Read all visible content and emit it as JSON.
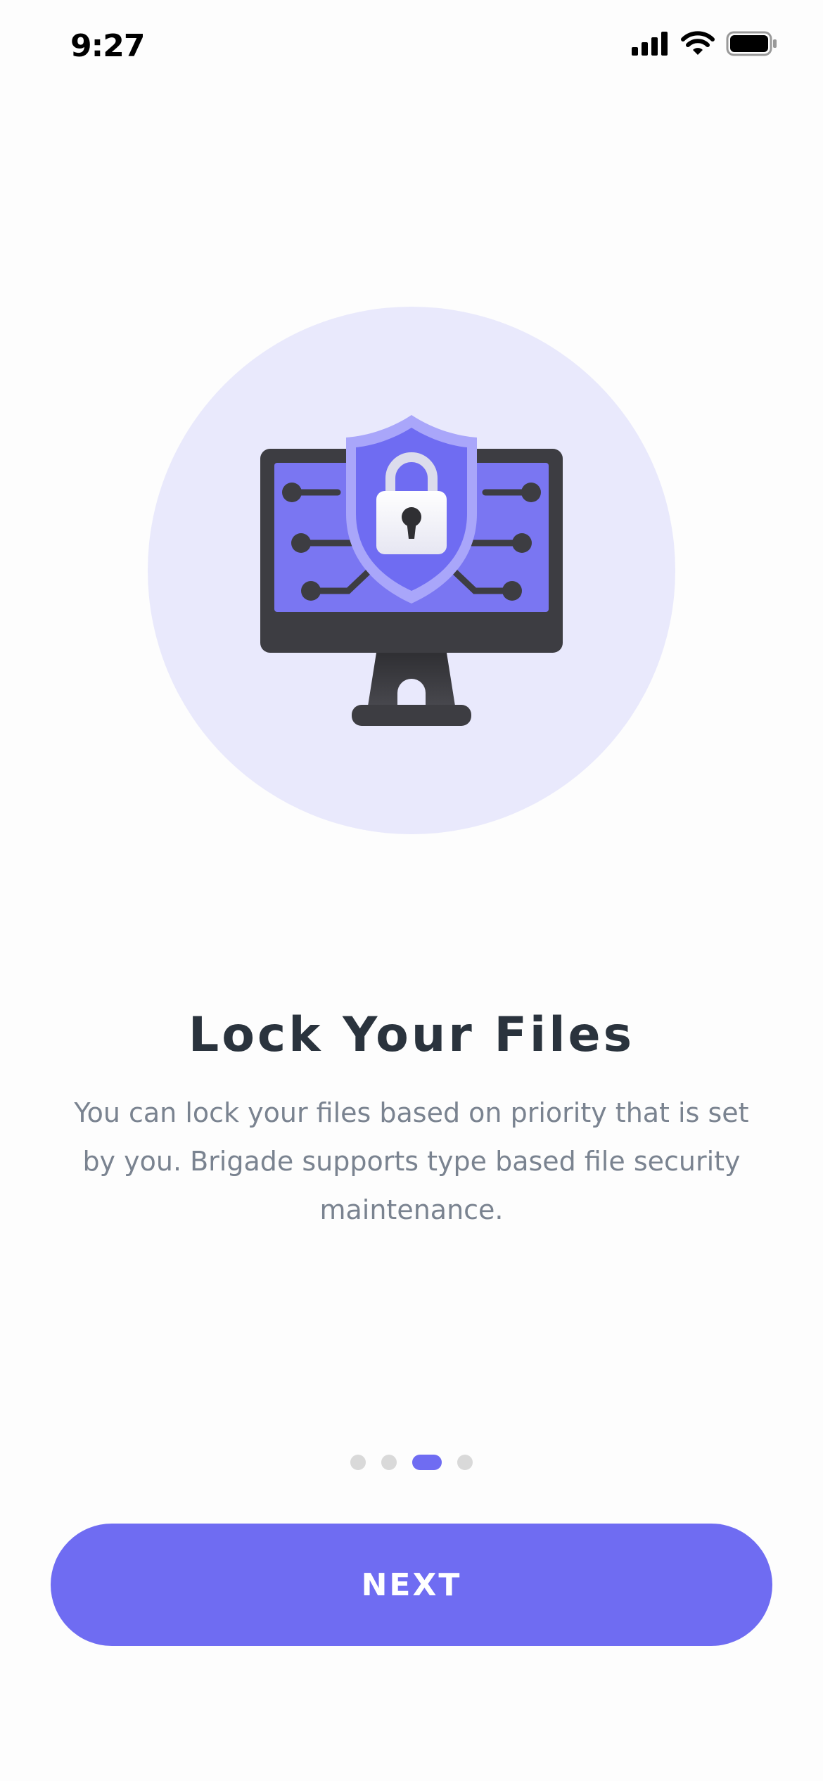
{
  "status_bar": {
    "time": "9:27",
    "icons": [
      "cellular-signal-icon",
      "wifi-icon",
      "battery-icon"
    ]
  },
  "onboarding": {
    "illustration": "monitor-shield-lock-icon",
    "title": "Lock Your Files",
    "description": "You can lock your files based on priority that is set by you. Brigade supports type based file security maintenance.",
    "pager": {
      "total_pages": 4,
      "current_page": 3
    },
    "next_label": "NEXT"
  },
  "colors": {
    "accent": "#6f6cf2",
    "hero_background": "#e9e9fc",
    "title_text": "#2a333d",
    "body_text": "#7a8390",
    "dot_inactive": "#d9d9d9"
  }
}
